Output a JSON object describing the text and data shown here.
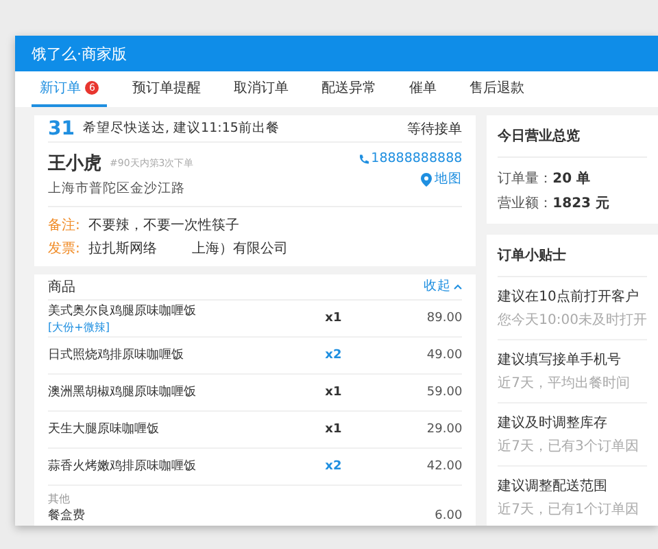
{
  "app": {
    "title": "饿了么·商家版"
  },
  "tabs": [
    {
      "label": "新订单",
      "badge": "6",
      "selected": true
    },
    {
      "label": "预订单提醒",
      "selected": false
    },
    {
      "label": "取消订单",
      "selected": false
    },
    {
      "label": "配送异常",
      "selected": false
    },
    {
      "label": "催单",
      "selected": false
    },
    {
      "label": "售后退款",
      "selected": false
    }
  ],
  "order": {
    "number": "31",
    "delivery_note": "希望尽快送达, 建议11:15前出餐",
    "status": "等待接单",
    "customer": {
      "name": "王小虎",
      "history": "#90天内第3次下单",
      "address": "上海市普陀区金沙江路",
      "phone": "18888888888",
      "map_link": "地图"
    },
    "remarks": [
      {
        "label": "备注:",
        "text": "不要辣，不要一次性筷子"
      },
      {
        "label": "发票:",
        "text": "拉扎斯网络        上海）有限公司"
      }
    ],
    "items_heading": "商品",
    "collapse_link": "收起",
    "items": [
      {
        "name": "美式奥尔良鸡腿原味咖喱饭",
        "spec": "[大份+微辣]",
        "qty": "x1",
        "highlight": false,
        "price": "89.00"
      },
      {
        "name": "日式照烧鸡排原味咖喱饭",
        "qty": "x2",
        "highlight": true,
        "price": "49.00"
      },
      {
        "name": "澳洲黑胡椒鸡腿原味咖喱饭",
        "qty": "x1",
        "highlight": false,
        "price": "59.00"
      },
      {
        "name": "天生大腿原味咖喱饭",
        "qty": "x1",
        "highlight": false,
        "price": "29.00"
      },
      {
        "name": "蒜香火烤嫩鸡排原味咖喱饭",
        "qty": "x2",
        "highlight": true,
        "price": "42.00"
      }
    ],
    "other_heading": "其他",
    "other_items": [
      {
        "name": "餐盒费",
        "price": "6.00"
      }
    ]
  },
  "summary": {
    "title": "今日营业总览",
    "stats": [
      {
        "label": "订单量：",
        "value": "20 单"
      },
      {
        "label": "营业额：",
        "value": "1823 元"
      }
    ]
  },
  "tips": {
    "title": "订单小贴士",
    "items": [
      {
        "title": "建议在10点前打开客户",
        "detail": "您今天10:00未及时打开"
      },
      {
        "title": "建议填写接单手机号",
        "detail": "近7天，平均出餐时间"
      },
      {
        "title": "建议及时调整库存",
        "detail": "近7天，已有3个订单因"
      },
      {
        "title": "建议调整配送范围",
        "detail": "近7天，已有1个订单因"
      }
    ]
  }
}
